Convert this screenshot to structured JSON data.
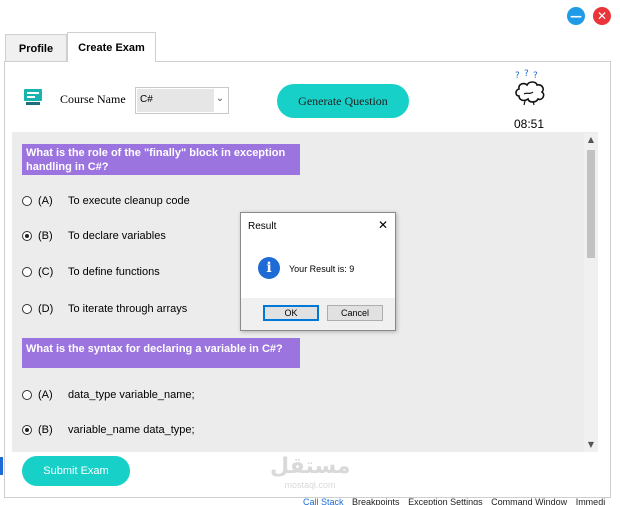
{
  "window": {
    "minimize_glyph": "—",
    "close_glyph": "✕"
  },
  "tabs": [
    {
      "label": "Profile"
    },
    {
      "label": "Create Exam"
    }
  ],
  "course": {
    "label": "Course Name",
    "value": "C#"
  },
  "generate_button": "Generate Question",
  "timer": "08:51",
  "questions": [
    {
      "text": "What is the role of the \"finally\" block in exception handling in C#?",
      "options": [
        {
          "letter": "(A)",
          "text": "To execute cleanup code",
          "selected": false
        },
        {
          "letter": "(B)",
          "text": "To declare variables",
          "selected": true
        },
        {
          "letter": "(C)",
          "text": "To define functions",
          "selected": false
        },
        {
          "letter": "(D)",
          "text": "To iterate through arrays",
          "selected": false
        }
      ]
    },
    {
      "text": "What is the syntax for declaring a variable in C#?",
      "options": [
        {
          "letter": "(A)",
          "text": "data_type variable_name;",
          "selected": false
        },
        {
          "letter": "(B)",
          "text": "variable_name data_type;",
          "selected": true
        }
      ]
    }
  ],
  "dialog": {
    "title": "Result",
    "message": "Your Result is: 9",
    "ok": "OK",
    "cancel": "Cancel",
    "close_glyph": "✕",
    "info_glyph": "i"
  },
  "submit_button": "Submit Exam",
  "bottom_bar": [
    "Call Stack",
    "Breakpoints",
    "Exception Settings",
    "Command Window",
    "Immedi"
  ],
  "watermark": {
    "arabic": "مستقل",
    "latin": "mostaql.com"
  },
  "colors": {
    "accent": "#17d0c8",
    "question_bg": "#9c74e0",
    "close": "#e8353b",
    "minimize": "#1e9be6",
    "info": "#1f6bd6"
  }
}
